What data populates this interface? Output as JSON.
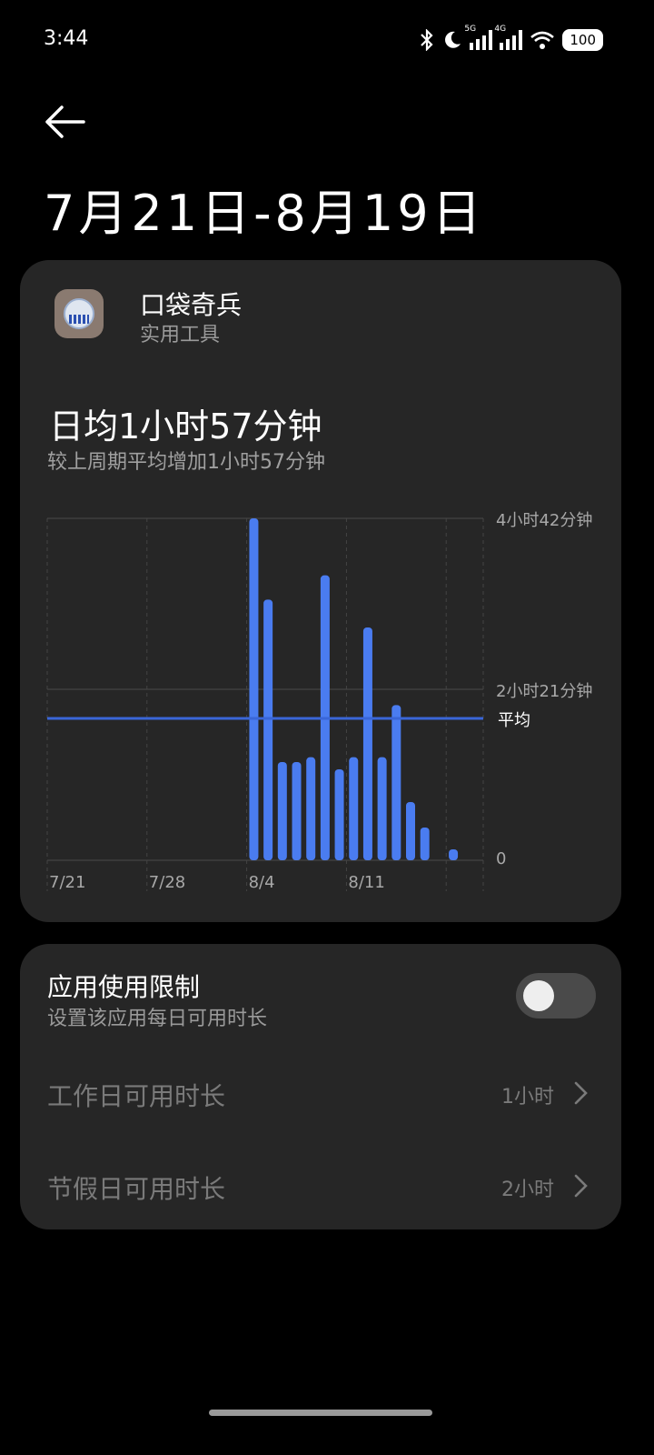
{
  "status_bar": {
    "time": "3:44",
    "battery": "100",
    "net1": "5G",
    "net2": "4G"
  },
  "header": {
    "title": "7月21日-8月19日"
  },
  "app": {
    "name": "口袋奇兵",
    "category": "实用工具"
  },
  "usage": {
    "daily_average": "日均1小时57分钟",
    "comparison": "较上周期平均增加1小时57分钟"
  },
  "chart_data": {
    "type": "bar",
    "y_tick_labels": [
      "4小时42分钟",
      "2小时21分钟",
      "0"
    ],
    "ylim": [
      0,
      282
    ],
    "average_label": "平均",
    "average_minutes": 117,
    "x_tick_labels": [
      "7/21",
      "7/28",
      "8/4",
      "8/11"
    ],
    "categories": [
      "7/21",
      "7/22",
      "7/23",
      "7/24",
      "7/25",
      "7/26",
      "7/27",
      "7/28",
      "7/29",
      "7/30",
      "7/31",
      "8/1",
      "8/2",
      "8/3",
      "8/4",
      "8/5",
      "8/6",
      "8/7",
      "8/8",
      "8/9",
      "8/10",
      "8/11",
      "8/12",
      "8/13",
      "8/14",
      "8/15",
      "8/16",
      "8/17",
      "8/18",
      "8/19"
    ],
    "values": [
      0,
      0,
      0,
      0,
      0,
      0,
      0,
      0,
      0,
      0,
      0,
      0,
      0,
      0,
      282,
      215,
      81,
      81,
      85,
      235,
      75,
      85,
      192,
      85,
      128,
      48,
      27,
      0,
      9,
      0
    ],
    "series_color": "#4a7cf0",
    "average_color": "#3a66d8"
  },
  "limits": {
    "title": "应用使用限制",
    "subtitle": "设置该应用每日可用时长",
    "toggle_on": false,
    "workday_label": "工作日可用时长",
    "workday_value": "1小时",
    "holiday_label": "节假日可用时长",
    "holiday_value": "2小时"
  }
}
